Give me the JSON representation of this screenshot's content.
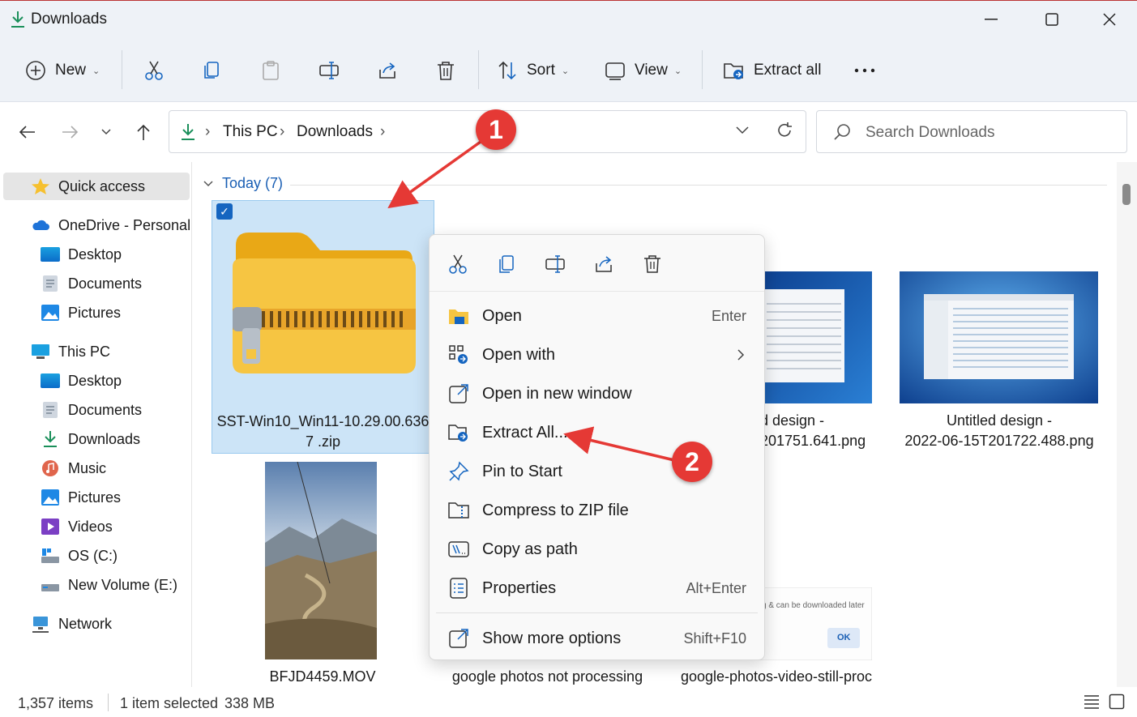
{
  "window": {
    "title": "Downloads"
  },
  "toolbar": {
    "new_label": "New",
    "sort_label": "Sort",
    "view_label": "View",
    "extract_label": "Extract all"
  },
  "address": {
    "crumbs": [
      "This PC",
      "Downloads"
    ]
  },
  "search": {
    "placeholder": "Search Downloads"
  },
  "sidebar": {
    "quick_access": "Quick access",
    "onedrive": "OneDrive - Personal",
    "onedrive_items": [
      "Desktop",
      "Documents",
      "Pictures"
    ],
    "this_pc": "This PC",
    "pc_items": [
      "Desktop",
      "Documents",
      "Downloads",
      "Music",
      "Pictures",
      "Videos",
      "OS (C:)",
      "New Volume (E:)"
    ],
    "network": "Network"
  },
  "content": {
    "group": "Today (7)",
    "files": [
      {
        "line1": "SST-Win10_Win11-10.29.00.636",
        "line2": "7 .zip"
      },
      {
        "line1": "d design -",
        "line2": "201751.641.png"
      },
      {
        "line1": "Untitled design -",
        "line2": "2022-06-15T201722.488.png"
      },
      {
        "line1": "BFJD4459.MOV"
      },
      {
        "line1": "google photos not processing"
      },
      {
        "line1": "google-photos-video-still-proc"
      }
    ],
    "dialog_text": "g & can be downloaded later",
    "dialog_ok": "OK"
  },
  "context_menu": {
    "items": [
      {
        "label": "Open",
        "key": "Enter"
      },
      {
        "label": "Open with",
        "key": ""
      },
      {
        "label": "Open in new window",
        "key": ""
      },
      {
        "label": "Extract All...",
        "key": ""
      },
      {
        "label": "Pin to Start",
        "key": ""
      },
      {
        "label": "Compress to ZIP file",
        "key": ""
      },
      {
        "label": "Copy as path",
        "key": ""
      },
      {
        "label": "Properties",
        "key": "Alt+Enter"
      },
      {
        "label": "Show more options",
        "key": "Shift+F10"
      }
    ]
  },
  "annotations": {
    "badge1": "1",
    "badge2": "2"
  },
  "status": {
    "count": "1,357 items",
    "selected": "1 item selected",
    "size": "338 MB"
  },
  "colors": {
    "accent": "#1565c0",
    "badge": "#e53935",
    "folder": "#f6c542",
    "selection": "#cce4f7"
  }
}
